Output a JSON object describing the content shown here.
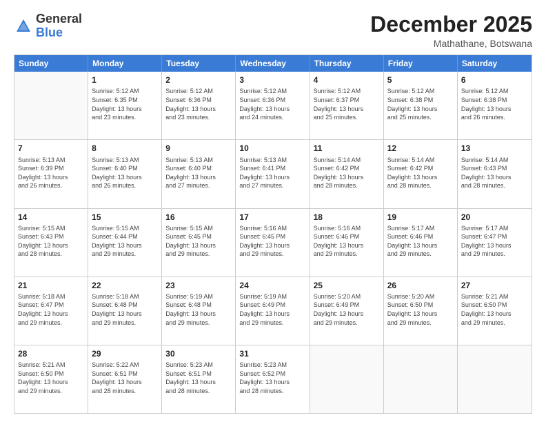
{
  "logo": {
    "general": "General",
    "blue": "Blue"
  },
  "header": {
    "month": "December 2025",
    "location": "Mathathane, Botswana"
  },
  "weekdays": [
    "Sunday",
    "Monday",
    "Tuesday",
    "Wednesday",
    "Thursday",
    "Friday",
    "Saturday"
  ],
  "weeks": [
    [
      {
        "day": "",
        "info": ""
      },
      {
        "day": "1",
        "info": "Sunrise: 5:12 AM\nSunset: 6:35 PM\nDaylight: 13 hours\nand 23 minutes."
      },
      {
        "day": "2",
        "info": "Sunrise: 5:12 AM\nSunset: 6:36 PM\nDaylight: 13 hours\nand 23 minutes."
      },
      {
        "day": "3",
        "info": "Sunrise: 5:12 AM\nSunset: 6:36 PM\nDaylight: 13 hours\nand 24 minutes."
      },
      {
        "day": "4",
        "info": "Sunrise: 5:12 AM\nSunset: 6:37 PM\nDaylight: 13 hours\nand 25 minutes."
      },
      {
        "day": "5",
        "info": "Sunrise: 5:12 AM\nSunset: 6:38 PM\nDaylight: 13 hours\nand 25 minutes."
      },
      {
        "day": "6",
        "info": "Sunrise: 5:12 AM\nSunset: 6:38 PM\nDaylight: 13 hours\nand 26 minutes."
      }
    ],
    [
      {
        "day": "7",
        "info": "Sunrise: 5:13 AM\nSunset: 6:39 PM\nDaylight: 13 hours\nand 26 minutes."
      },
      {
        "day": "8",
        "info": "Sunrise: 5:13 AM\nSunset: 6:40 PM\nDaylight: 13 hours\nand 26 minutes."
      },
      {
        "day": "9",
        "info": "Sunrise: 5:13 AM\nSunset: 6:40 PM\nDaylight: 13 hours\nand 27 minutes."
      },
      {
        "day": "10",
        "info": "Sunrise: 5:13 AM\nSunset: 6:41 PM\nDaylight: 13 hours\nand 27 minutes."
      },
      {
        "day": "11",
        "info": "Sunrise: 5:14 AM\nSunset: 6:42 PM\nDaylight: 13 hours\nand 28 minutes."
      },
      {
        "day": "12",
        "info": "Sunrise: 5:14 AM\nSunset: 6:42 PM\nDaylight: 13 hours\nand 28 minutes."
      },
      {
        "day": "13",
        "info": "Sunrise: 5:14 AM\nSunset: 6:43 PM\nDaylight: 13 hours\nand 28 minutes."
      }
    ],
    [
      {
        "day": "14",
        "info": "Sunrise: 5:15 AM\nSunset: 6:43 PM\nDaylight: 13 hours\nand 28 minutes."
      },
      {
        "day": "15",
        "info": "Sunrise: 5:15 AM\nSunset: 6:44 PM\nDaylight: 13 hours\nand 29 minutes."
      },
      {
        "day": "16",
        "info": "Sunrise: 5:15 AM\nSunset: 6:45 PM\nDaylight: 13 hours\nand 29 minutes."
      },
      {
        "day": "17",
        "info": "Sunrise: 5:16 AM\nSunset: 6:45 PM\nDaylight: 13 hours\nand 29 minutes."
      },
      {
        "day": "18",
        "info": "Sunrise: 5:16 AM\nSunset: 6:46 PM\nDaylight: 13 hours\nand 29 minutes."
      },
      {
        "day": "19",
        "info": "Sunrise: 5:17 AM\nSunset: 6:46 PM\nDaylight: 13 hours\nand 29 minutes."
      },
      {
        "day": "20",
        "info": "Sunrise: 5:17 AM\nSunset: 6:47 PM\nDaylight: 13 hours\nand 29 minutes."
      }
    ],
    [
      {
        "day": "21",
        "info": "Sunrise: 5:18 AM\nSunset: 6:47 PM\nDaylight: 13 hours\nand 29 minutes."
      },
      {
        "day": "22",
        "info": "Sunrise: 5:18 AM\nSunset: 6:48 PM\nDaylight: 13 hours\nand 29 minutes."
      },
      {
        "day": "23",
        "info": "Sunrise: 5:19 AM\nSunset: 6:48 PM\nDaylight: 13 hours\nand 29 minutes."
      },
      {
        "day": "24",
        "info": "Sunrise: 5:19 AM\nSunset: 6:49 PM\nDaylight: 13 hours\nand 29 minutes."
      },
      {
        "day": "25",
        "info": "Sunrise: 5:20 AM\nSunset: 6:49 PM\nDaylight: 13 hours\nand 29 minutes."
      },
      {
        "day": "26",
        "info": "Sunrise: 5:20 AM\nSunset: 6:50 PM\nDaylight: 13 hours\nand 29 minutes."
      },
      {
        "day": "27",
        "info": "Sunrise: 5:21 AM\nSunset: 6:50 PM\nDaylight: 13 hours\nand 29 minutes."
      }
    ],
    [
      {
        "day": "28",
        "info": "Sunrise: 5:21 AM\nSunset: 6:50 PM\nDaylight: 13 hours\nand 29 minutes."
      },
      {
        "day": "29",
        "info": "Sunrise: 5:22 AM\nSunset: 6:51 PM\nDaylight: 13 hours\nand 28 minutes."
      },
      {
        "day": "30",
        "info": "Sunrise: 5:23 AM\nSunset: 6:51 PM\nDaylight: 13 hours\nand 28 minutes."
      },
      {
        "day": "31",
        "info": "Sunrise: 5:23 AM\nSunset: 6:52 PM\nDaylight: 13 hours\nand 28 minutes."
      },
      {
        "day": "",
        "info": ""
      },
      {
        "day": "",
        "info": ""
      },
      {
        "day": "",
        "info": ""
      }
    ]
  ]
}
